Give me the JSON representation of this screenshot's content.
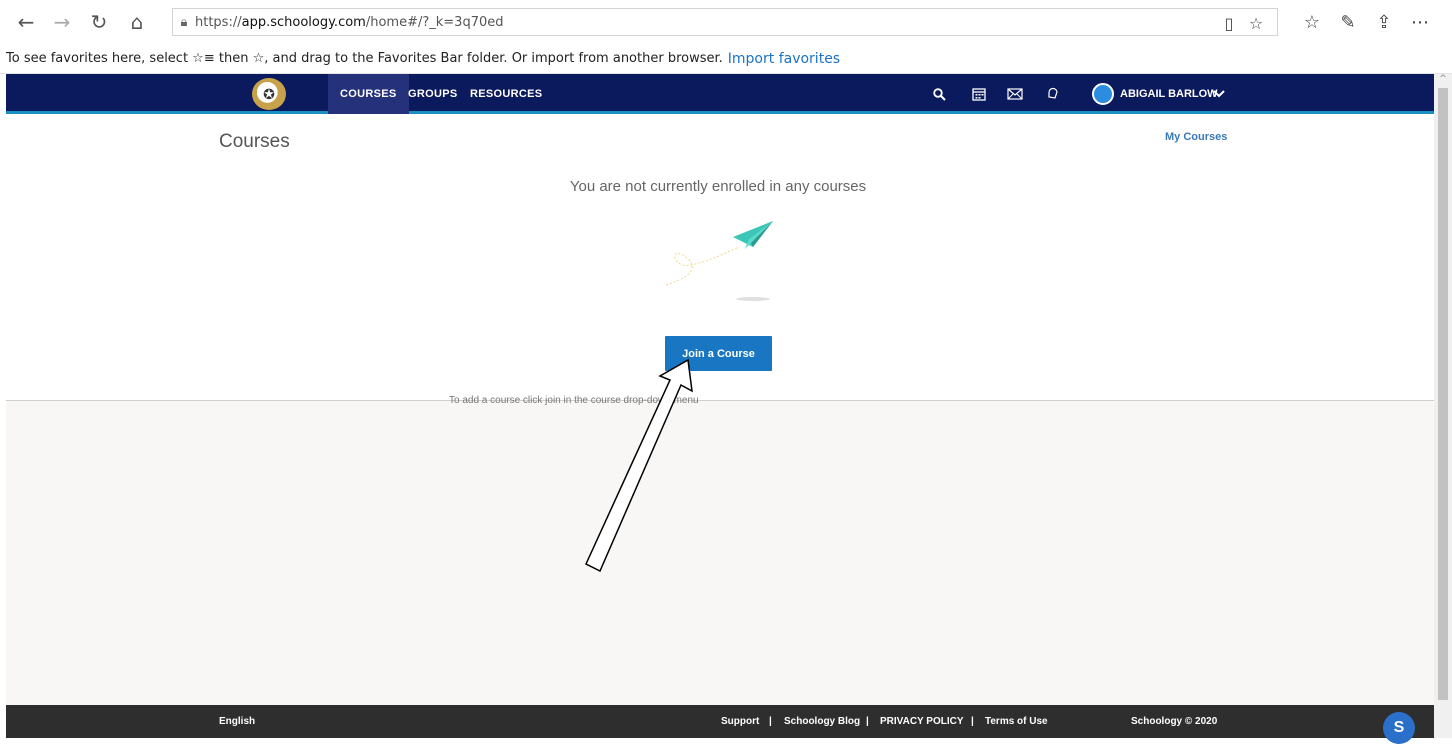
{
  "browser": {
    "url_prefix": "https://",
    "url_domain": "app.schoology.com",
    "url_path": "/home#/?_k=3q70ed",
    "back_icon": "back-arrow-icon",
    "forward_icon": "forward-arrow-icon",
    "refresh_icon": "refresh-icon",
    "home_icon": "home-icon"
  },
  "favbar": {
    "message": "To see favorites here, select ☆≡ then ☆, and drag to the Favorites Bar folder. Or import from another browser.",
    "import_link": "Import favorites"
  },
  "header": {
    "tabs": [
      {
        "label": "COURSES",
        "active": true
      },
      {
        "label": "GROUPS",
        "active": false
      },
      {
        "label": "RESOURCES",
        "active": false
      }
    ],
    "user_name": "ABIGAIL BARLOW"
  },
  "main": {
    "title": "Courses",
    "my_courses_link": "My Courses",
    "empty_message": "You are not currently enrolled in any courses",
    "join_button": "Join a Course",
    "hint": "To add a course click join in the course drop-down menu"
  },
  "footer": {
    "language": "English",
    "links": [
      "Support",
      "|",
      "Schoology Blog",
      "|",
      "PRIVACY POLICY",
      "|",
      "Terms of Use"
    ],
    "copyright": "Schoology © 2020",
    "badge": "S"
  },
  "colors": {
    "header_bg": "#0a1a5c",
    "accent": "#1876c2",
    "footer_bg": "#2e2e2e"
  }
}
